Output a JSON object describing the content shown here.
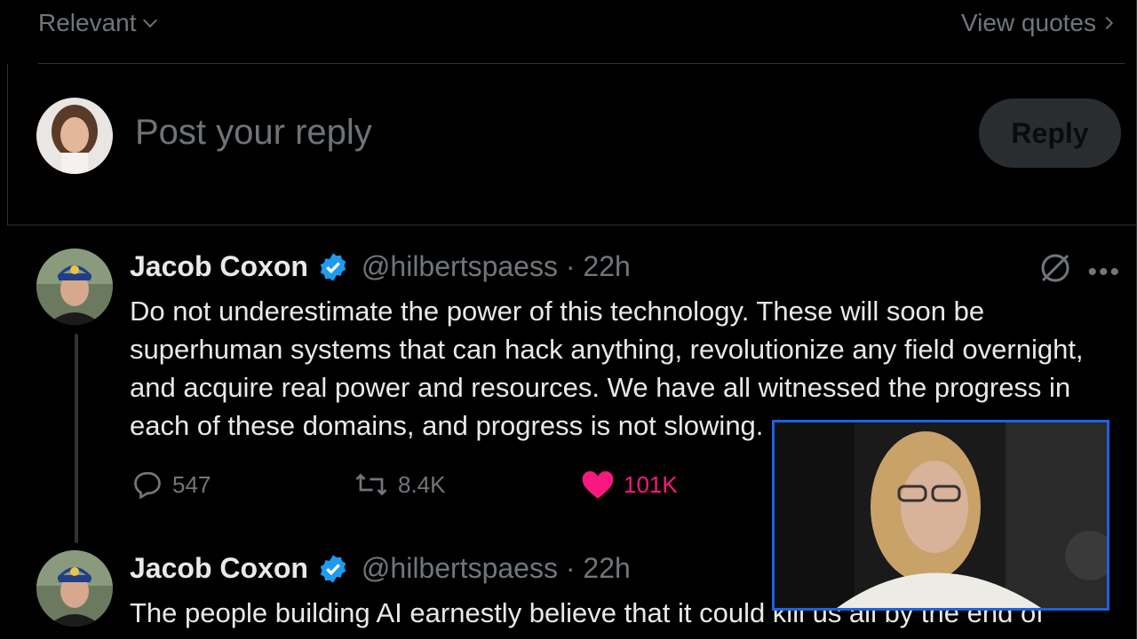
{
  "topbar": {
    "sort_label": "Relevant",
    "view_quotes_label": "View quotes"
  },
  "composer": {
    "placeholder": "Post your reply",
    "reply_label": "Reply"
  },
  "tweets": [
    {
      "name": "Jacob Coxon",
      "handle_time": "@hilbertspaess · 22h",
      "text": "Do not underestimate the power of this technology. These will soon be superhuman systems that can hack anything, revolutionize any field overnight, and acquire real power and resources. We have all witnessed the progress in each of these domains, and progress is not slowing.",
      "replies": "547",
      "reposts": "8.4K",
      "likes": "101K"
    },
    {
      "name": "Jacob Coxon",
      "handle_time": "@hilbertspaess · 22h",
      "text": "The people building AI earnestly believe that it could kill us all by the end of"
    }
  ],
  "colors": {
    "accent_blue": "#1d9bf0",
    "like_pink": "#f91880",
    "video_border": "#1a62e8"
  },
  "icons": [
    "chevron-down-icon",
    "chevron-right-icon",
    "verified-badge-icon",
    "grok-icon",
    "more-icon",
    "reply-icon",
    "repost-icon",
    "heart-icon"
  ]
}
